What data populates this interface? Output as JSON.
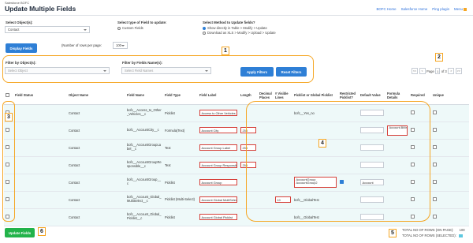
{
  "header": {
    "brand": "Salesforce BOFC",
    "title": "Update Multiple Fields",
    "links": [
      "BOFC Home",
      "Salesforce Home",
      "Ping plugin",
      "Menu"
    ]
  },
  "controls": {
    "select_objects_label": "Select Object(s):",
    "select_objects_value": "Contact",
    "field_type_label": "Select type of Field to update:",
    "field_type_option": "Custom Fields",
    "method_label": "Select Method to Update fields?",
    "method_options": [
      "Show directly in Table > Modify > Update",
      "Download as XLS > Modify > Upload > Update"
    ],
    "rows_per_page_label": "(Number of rows per page:",
    "rows_per_page_value": "100",
    "display_fields_button": "Display Fields"
  },
  "filters": {
    "by_objects_label": "Filter by Object(s):",
    "by_objects_placeholder": "Select Object",
    "by_names_label": "Filter by Fields Name(s):",
    "by_names_placeholder": "Select Field Names",
    "apply_button": "Apply Filters",
    "reset_button": "Reset Filters"
  },
  "pager": {
    "first": "<<",
    "prev": "<",
    "page_label": "Page",
    "page_value": "1",
    "of_label": "of 3",
    "next": ">",
    "last": ">>"
  },
  "table": {
    "columns": [
      "",
      "Field Status",
      "Object Name",
      "Field Name",
      "Field Type",
      "Field Label",
      "Length",
      "Decimal Places",
      "# Visible Lines",
      "Picklist or Global Picklist",
      "Restricted Picklist?",
      "Default Value",
      "Formula Details",
      "Required",
      "Unique"
    ],
    "rows": [
      {
        "object": "Contact",
        "name": "bofc__Access_to_Other_Vehicles__c",
        "type": "Picklist",
        "label": "Access to Other Vehicles",
        "length": "",
        "decimal": "",
        "lines": "",
        "picklist": "bofc__Yes_no",
        "restricted": false,
        "default": "",
        "formula": ""
      },
      {
        "object": "Contact",
        "name": "bofc__AccountCity__c",
        "type": "Formula(Text)",
        "label": "Account City",
        "length": "255",
        "decimal": "",
        "lines": "",
        "picklist": "",
        "restricted": false,
        "default": "",
        "formula": "Account.BillingCity"
      },
      {
        "object": "Contact",
        "name": "bofc__AccountGroupLabel__c",
        "type": "Text",
        "label": "Account Group Label",
        "length": "255",
        "decimal": "",
        "lines": "",
        "picklist": "",
        "restricted": false,
        "default": "",
        "formula": ""
      },
      {
        "object": "Contact",
        "name": "bofc__AccountGroupResponsible__c",
        "type": "Text",
        "label": "Account Group Responsible",
        "length": "255",
        "decimal": "",
        "lines": "",
        "picklist": "",
        "restricted": false,
        "default": "",
        "formula": ""
      },
      {
        "object": "Contact",
        "name": "bofc__AccountGroup__c",
        "type": "Picklist",
        "label": "Account Group",
        "length": "",
        "decimal": "",
        "lines": "",
        "picklist": "AccountGroup AccountGroup2",
        "restricted": true,
        "default": "Account",
        "formula": ""
      },
      {
        "object": "Contact",
        "name": "bofc__Account_Global_MultiSelect__c",
        "type": "Picklist (Multi-Select)",
        "label": "Account Global MultiSelect",
        "length": "",
        "decimal": "",
        "lines": "10",
        "picklist": "bofc__GlobalTest",
        "restricted": false,
        "default": "",
        "formula": ""
      },
      {
        "object": "Contact",
        "name": "bofc__Account_Global_Picklist__c",
        "type": "Picklist",
        "label": "Account Global Picklist",
        "length": "",
        "decimal": "",
        "lines": "",
        "picklist": "bofc__GlobalTest",
        "restricted": false,
        "default": "",
        "formula": ""
      }
    ]
  },
  "footer": {
    "update_button": "Update Fields",
    "total_on_page_label": "TOTAL NO OF ROWS (ON PAGE):",
    "total_on_page_value": "100",
    "total_selected_label": "TOTAL NO OF ROWS (SELECTED):",
    "selected_color": "#5ec8e0"
  },
  "callouts": [
    "1",
    "2",
    "3",
    "4",
    "5",
    "6"
  ],
  "colors": {
    "accent": "#2e7fd6",
    "success": "#22b34a",
    "callout": "#f5a623",
    "row_bg": "#eef9f9",
    "error_border": "#d6403a"
  }
}
